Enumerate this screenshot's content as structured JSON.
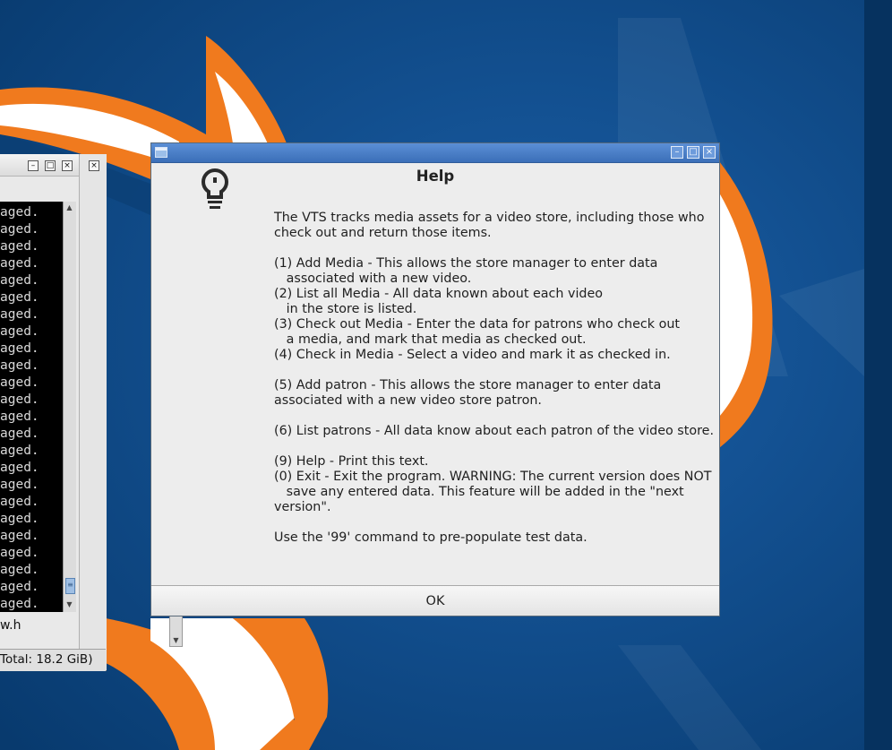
{
  "background_window": {
    "terminal_lines": [
      "aged.",
      "aged.",
      "aged.",
      "aged.",
      "aged.",
      "aged.",
      "aged.",
      "aged.",
      "aged.",
      "aged.",
      "aged.",
      "aged.",
      "aged.",
      "aged.",
      "aged.",
      "aged.",
      "aged.",
      "aged.",
      "aged.",
      "aged.",
      "aged.",
      "aged.",
      "aged.",
      "aged."
    ],
    "filename_fragment": "w.h",
    "status_text": "Total: 18.2 GiB)",
    "title_buttons": {
      "minimize": "–",
      "maximize": "□",
      "close": "×"
    },
    "refresh_icon_glyph": "↷",
    "scroll_up": "▲",
    "scroll_down": "▼",
    "scroll_grip": "≡"
  },
  "dialog": {
    "title": "Help",
    "window_buttons": {
      "minimize": "–",
      "maximize": "□",
      "close": "×"
    },
    "icon": "lightbulb-icon",
    "paragraphs": [
      "The VTS tracks media assets for a video store, including those who",
      "check out and return those items.",
      "",
      "(1) Add Media - This allows the store manager to enter data",
      "   associated with a new video.",
      "(2) List all Media - All data known about each video",
      "   in the store is listed.",
      "(3) Check out Media - Enter the data for patrons who check out",
      "   a media, and mark that media as checked out.",
      "(4) Check in Media - Select a video and mark it as checked in.",
      "",
      "(5) Add patron - This allows the store manager to enter data",
      "associated with a new video store patron.",
      "",
      "(6) List patrons - All data know about each patron of the video store.",
      "",
      "(9) Help - Print this text.",
      "(0) Exit - Exit the program. WARNING: The current version does NOT",
      "   save any entered data. This feature will be added in the \"next",
      "version\".",
      "",
      "Use the '99' command to pre-populate test data."
    ],
    "ok_label": "OK"
  },
  "colors": {
    "wallpaper_blue": "#0d4a87",
    "wallpaper_orange": "#f07a1e",
    "titlebar_blue": "#4a7fc8"
  }
}
